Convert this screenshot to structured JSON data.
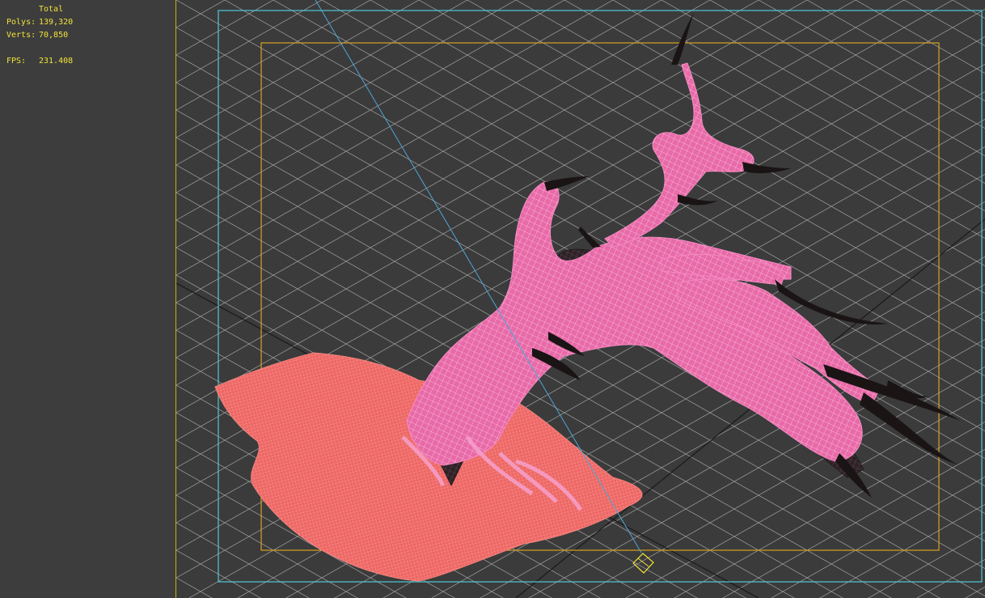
{
  "stats": {
    "total_label": "Total",
    "polys_label": "Polys:",
    "polys_value": "139,320",
    "verts_label": "Verts:",
    "verts_value": "70,850",
    "fps_label": "FPS:",
    "fps_value": "231.408"
  },
  "colors": {
    "background": "#3d3d3d",
    "grid": "#bdbdbd",
    "stats_text": "#f0e23a",
    "safe_frame_outer": "#4fc8d8",
    "safe_frame_inner": "#d8a020",
    "camera_line": "#4aa8d8",
    "ground_mesh": "#ef6a66",
    "tree_mesh": "#ef80b6",
    "tree_shadow": "#2a1e22"
  },
  "icons": {
    "camera_target": "diamond-target-icon"
  }
}
